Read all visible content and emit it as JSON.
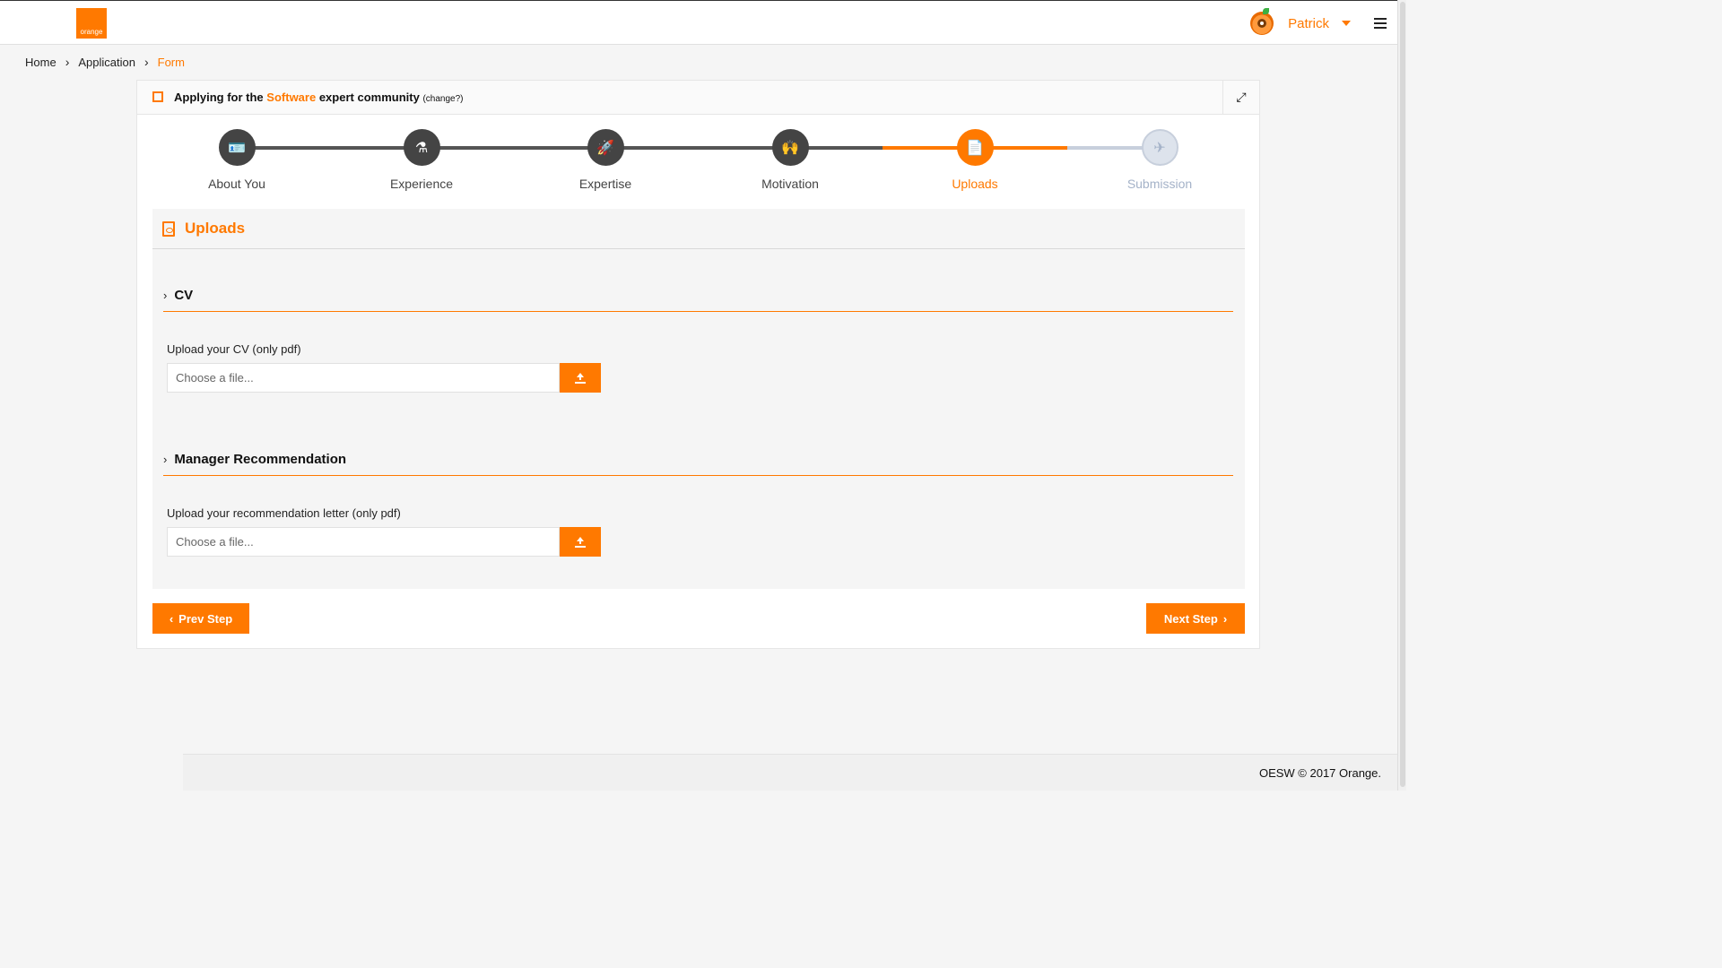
{
  "brand": {
    "logo_text": "orange",
    "accent": "#ff7900"
  },
  "user": {
    "name": "Patrick"
  },
  "breadcrumb": {
    "items": [
      "Home",
      "Application"
    ],
    "current": "Form"
  },
  "header": {
    "prefix": "Applying for the",
    "community": "Software",
    "suffix": "expert community",
    "change_link": "(change?)"
  },
  "stepper": {
    "steps": [
      {
        "label": "About You",
        "icon": "id-card-icon",
        "status": "done"
      },
      {
        "label": "Experience",
        "icon": "flask-icon",
        "status": "done"
      },
      {
        "label": "Expertise",
        "icon": "rocket-icon",
        "status": "done"
      },
      {
        "label": "Motivation",
        "icon": "person-raising-hands-icon",
        "status": "done"
      },
      {
        "label": "Uploads",
        "icon": "pdf-file-icon",
        "status": "active"
      },
      {
        "label": "Submission",
        "icon": "paper-plane-icon",
        "status": "pending"
      }
    ]
  },
  "panel": {
    "title": "Uploads",
    "sections": [
      {
        "title": "CV",
        "label": "Upload your CV (only pdf)",
        "placeholder": "Choose a file..."
      },
      {
        "title": "Manager Recommendation",
        "label": "Upload your recommendation letter (only pdf)",
        "placeholder": "Choose a file..."
      }
    ]
  },
  "nav": {
    "prev": "Prev Step",
    "next": "Next Step"
  },
  "footer": {
    "text": "OESW © 2017 Orange."
  }
}
